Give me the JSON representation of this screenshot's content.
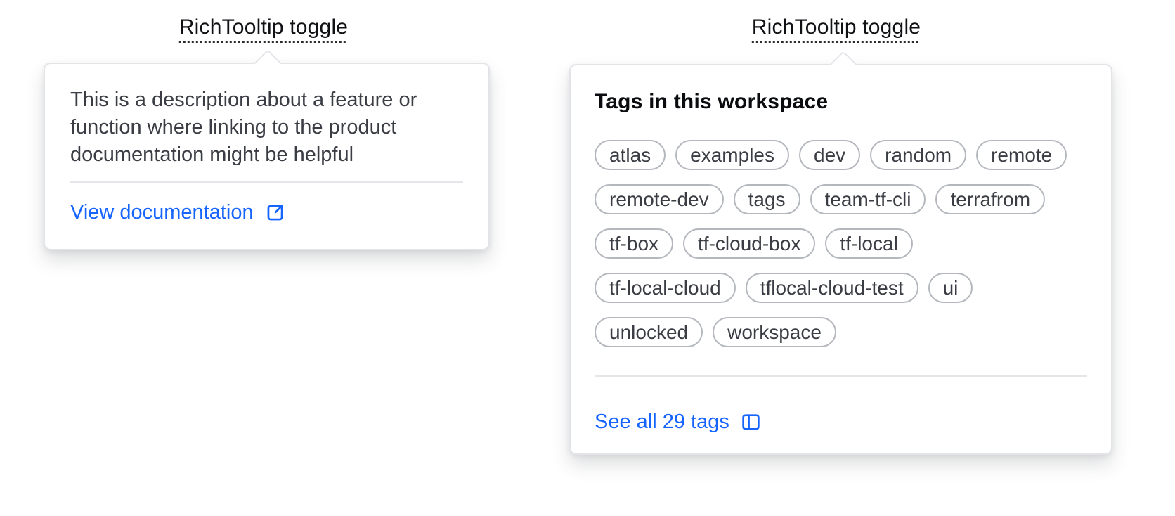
{
  "left_tooltip": {
    "trigger_label": "RichTooltip toggle",
    "description": "This is a description about a feature or function where linking to the product documentation might be helpful",
    "link_label": "View documentation",
    "link_icon": "external-link-icon"
  },
  "right_tooltip": {
    "trigger_label": "RichTooltip toggle",
    "heading": "Tags in this workspace",
    "tag_rows": [
      [
        "atlas",
        "examples",
        "dev",
        "random",
        "remote"
      ],
      [
        "remote-dev",
        "tags",
        "team-tf-cli",
        "terrafrom"
      ],
      [
        "tf-box",
        "tf-cloud-box",
        "tf-local"
      ],
      [
        "tf-local-cloud",
        "tflocal-cloud-test",
        "ui"
      ],
      [
        "unlocked",
        "workspace"
      ]
    ],
    "link_label": "See all 29 tags",
    "link_icon": "sidebar-panel-icon"
  },
  "colors": {
    "link_blue": "#1564ff",
    "text_primary": "#3b3d45",
    "card_border": "#e2e4e8",
    "pill_border": "#b4b8be"
  }
}
